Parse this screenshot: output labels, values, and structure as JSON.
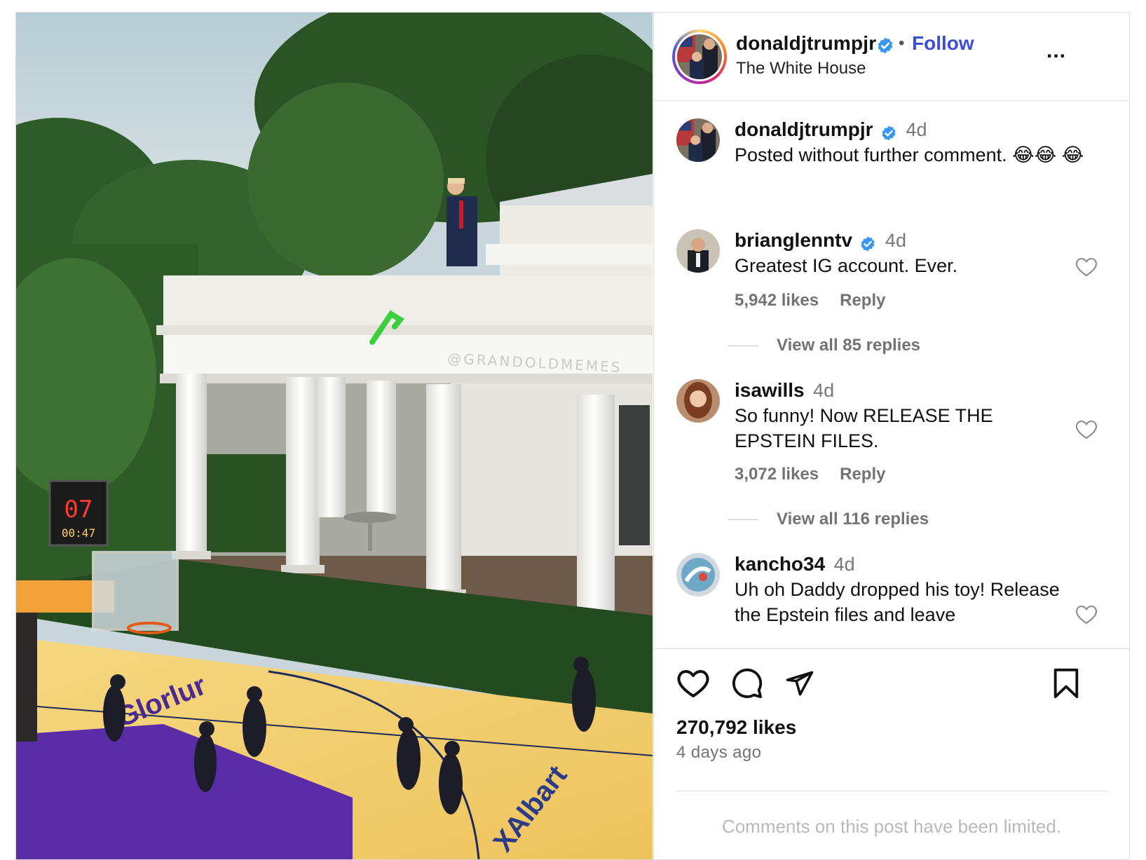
{
  "post": {
    "username": "donaldjtrumpjr",
    "follow_label": "Follow",
    "separator": "•",
    "location": "The White House",
    "more_label": "...",
    "watermark": "@GRANDOLDMEMES",
    "scoreboard": {
      "top": "07",
      "bottom": "00:47"
    },
    "court_text_1": "Glorlur",
    "court_text_2": "XAlbart"
  },
  "caption": {
    "username": "donaldjtrumpjr",
    "age": "4d",
    "text": "Posted without further comment. 😂😂 😂"
  },
  "comments": [
    {
      "username": "brianglenntv",
      "verified": true,
      "age": "4d",
      "text": "Greatest IG account. Ever.",
      "likes": "5,942 likes",
      "reply": "Reply",
      "view_replies": "View all 85 replies"
    },
    {
      "username": "isawills",
      "verified": false,
      "age": "4d",
      "text": "So funny! Now RELEASE THE EPSTEIN FILES.",
      "likes": "3,072 likes",
      "reply": "Reply",
      "view_replies": "View all 116 replies"
    },
    {
      "username": "kancho34",
      "verified": false,
      "age": "4d",
      "text": "Uh oh Daddy dropped his toy! Release the Epstein files and leave"
    }
  ],
  "actions": {
    "likes": "270,792 likes",
    "ago": "4 days ago",
    "limited": "Comments on this post have been limited."
  },
  "colors": {
    "follow": "#3b4ed6",
    "verified": "#3897f0",
    "court_purple": "#5a2ca8",
    "court_wood": "#f2cf6b"
  },
  "icons": [
    "verified-badge-icon",
    "more-options-icon",
    "heart-icon",
    "comment-icon",
    "share-icon",
    "bookmark-icon"
  ]
}
